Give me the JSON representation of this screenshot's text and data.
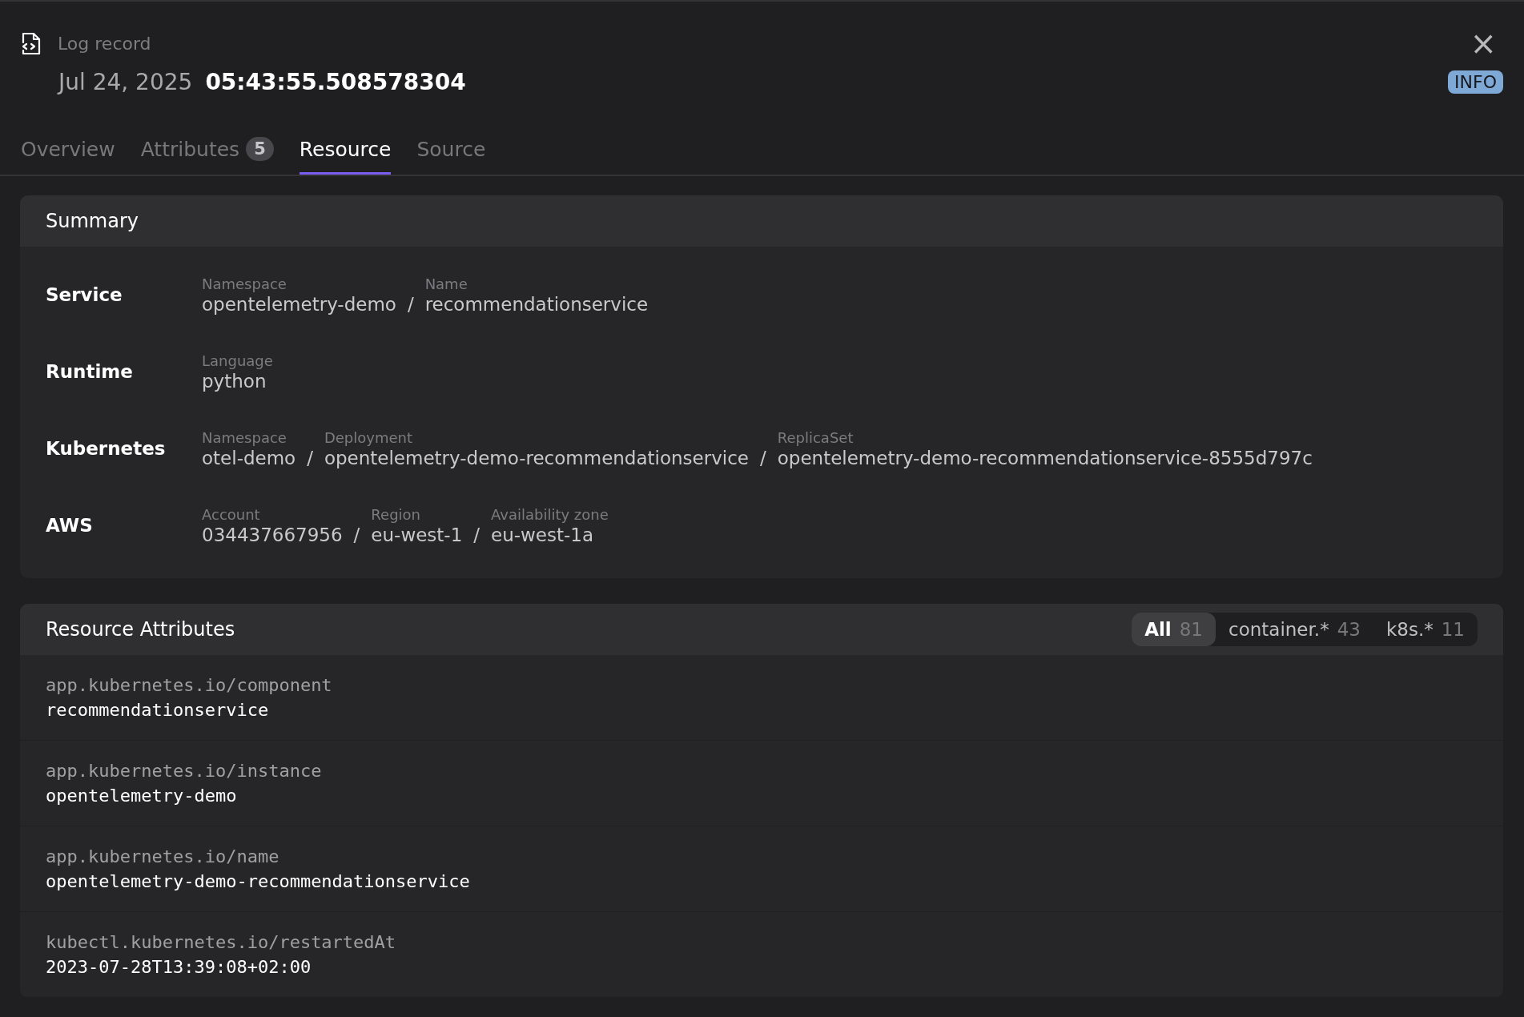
{
  "header": {
    "title": "Log record",
    "date": "Jul 24, 2025",
    "time": "05:43:55.508578304",
    "severity": "INFO",
    "close": "×"
  },
  "tabs": [
    {
      "label": "Overview",
      "selected": false
    },
    {
      "label": "Attributes",
      "count": "5",
      "selected": false
    },
    {
      "label": "Resource",
      "selected": true
    },
    {
      "label": "Source",
      "selected": false
    }
  ],
  "summary": {
    "title": "Summary",
    "rows": [
      {
        "label": "Service",
        "fields": [
          {
            "name": "Namespace",
            "value": "opentelemetry-demo"
          },
          {
            "sep": "/",
            "name": "Name",
            "value": "recommendationservice"
          }
        ]
      },
      {
        "label": "Runtime",
        "fields": [
          {
            "name": "Language",
            "value": "python"
          }
        ]
      },
      {
        "label": "Kubernetes",
        "fields": [
          {
            "name": "Namespace",
            "value": "otel-demo"
          },
          {
            "sep": "/",
            "name": "Deployment",
            "value": "opentelemetry-demo-recommendationservice"
          },
          {
            "sep": "/",
            "name": "ReplicaSet",
            "value": "opentelemetry-demo-recommendationservice-8555d797c"
          }
        ]
      },
      {
        "label": "AWS",
        "fields": [
          {
            "name": "Account",
            "value": "034437667956"
          },
          {
            "sep": "/",
            "name": "Region",
            "value": "eu-west-1"
          },
          {
            "sep": "/",
            "name": "Availability zone",
            "value": "eu-west-1a"
          }
        ]
      }
    ]
  },
  "resource_attributes": {
    "title": "Resource Attributes",
    "filters": [
      {
        "label": "All",
        "count": "81",
        "selected": true
      },
      {
        "label": "container.*",
        "count": "43",
        "selected": false
      },
      {
        "label": "k8s.*",
        "count": "11",
        "selected": false
      }
    ],
    "rows": [
      {
        "key": "app.kubernetes.io/component",
        "value": "recommendationservice"
      },
      {
        "key": "app.kubernetes.io/instance",
        "value": "opentelemetry-demo"
      },
      {
        "key": "app.kubernetes.io/name",
        "value": "opentelemetry-demo-recommendationservice"
      },
      {
        "key": "kubectl.kubernetes.io/restartedAt",
        "value": "2023-07-28T13:39:08+02:00"
      }
    ]
  }
}
